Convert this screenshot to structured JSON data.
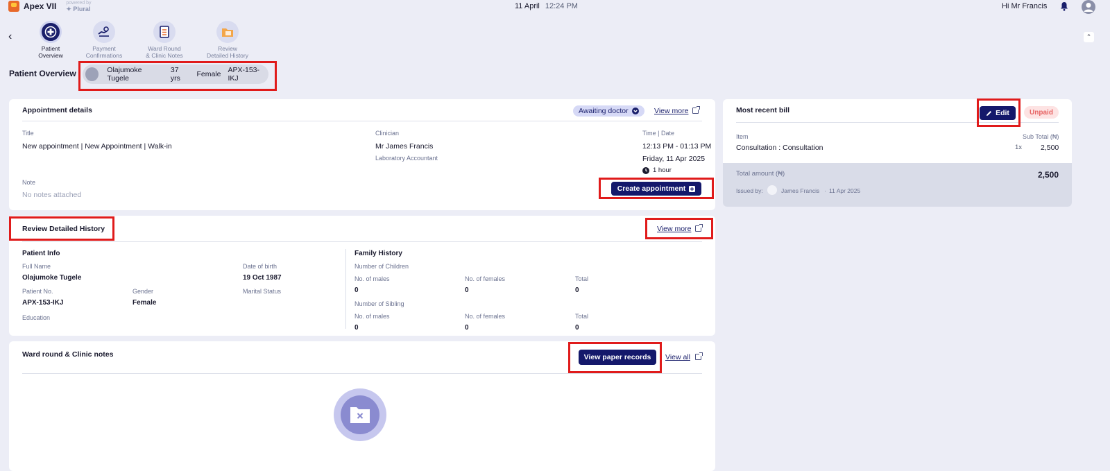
{
  "header": {
    "app_name": "Apex VII",
    "powered_by": "powered by",
    "plural": "Plural",
    "date": "11 April",
    "time": "12:24 PM",
    "greeting": "Hi Mr Francis"
  },
  "steps": [
    {
      "label_1": "Patient",
      "label_2": "Overview",
      "active": true
    },
    {
      "label_1": "Payment",
      "label_2": "Confirmations",
      "active": false
    },
    {
      "label_1": "Ward Round",
      "label_2": "& Clinic Notes",
      "active": false
    },
    {
      "label_1": "Review",
      "label_2": "Detailed History",
      "active": false
    }
  ],
  "patient_overview": {
    "title": "Patient Overview",
    "name": "Olajumoke Tugele",
    "age": "37 yrs",
    "gender": "Female",
    "id": "APX-153-IKJ"
  },
  "appointment": {
    "title": "Appointment details",
    "status": "Awaiting doctor",
    "view_more": "View more",
    "title_label": "Title",
    "title_value": "New appointment | New Appointment | Walk-in",
    "clinician_label": "Clinician",
    "clinician_name": "Mr James Francis",
    "clinician_role": "Laboratory Accountant",
    "time_label": "Time | Date",
    "time_value": "12:13 PM - 01:13 PM",
    "date_value": "Friday, 11 Apr 2025",
    "duration": "1 hour",
    "note_label": "Note",
    "note_value": "No notes attached",
    "create_button": "Create appointment"
  },
  "history": {
    "title": "Review Detailed History",
    "view_more": "View more",
    "patient_info": "Patient Info",
    "full_name_label": "Full Name",
    "full_name": "Olajumoke Tugele",
    "dob_label": "Date of birth",
    "dob": "19 Oct 1987",
    "patient_no_label": "Patient No.",
    "patient_no": "APX-153-IKJ",
    "gender_label": "Gender",
    "gender": "Female",
    "marital_label": "Marital Status",
    "education_label": "Education",
    "family_history": "Family History",
    "children_label": "Number of Children",
    "sibling_label": "Number of Sibling",
    "males_label": "No. of males",
    "females_label": "No. of females",
    "total_label": "Total",
    "children_males": "0",
    "children_females": "0",
    "children_total": "0",
    "sibling_males": "0",
    "sibling_females": "0",
    "sibling_total": "0"
  },
  "ward": {
    "title": "Ward round & Clinic notes",
    "paper_button": "View paper records",
    "view_all": "View all"
  },
  "bill": {
    "title": "Most recent bill",
    "edit": "Edit",
    "status": "Unpaid",
    "item_label": "Item",
    "subtotal_label": "Sub Total (₦)",
    "item": "Consultation : Consultation",
    "qty": "1x",
    "item_amount": "2,500",
    "total_label": "Total amount (₦)",
    "total": "2,500",
    "issued_by_label": "Issued by:",
    "issued_by": "James Francis",
    "issued_date": "11 Apr 2025"
  },
  "colors": {
    "primary": "#14186b",
    "background": "#ecedf6",
    "highlight": "#e01b1b",
    "unpaid": "#e76565"
  }
}
